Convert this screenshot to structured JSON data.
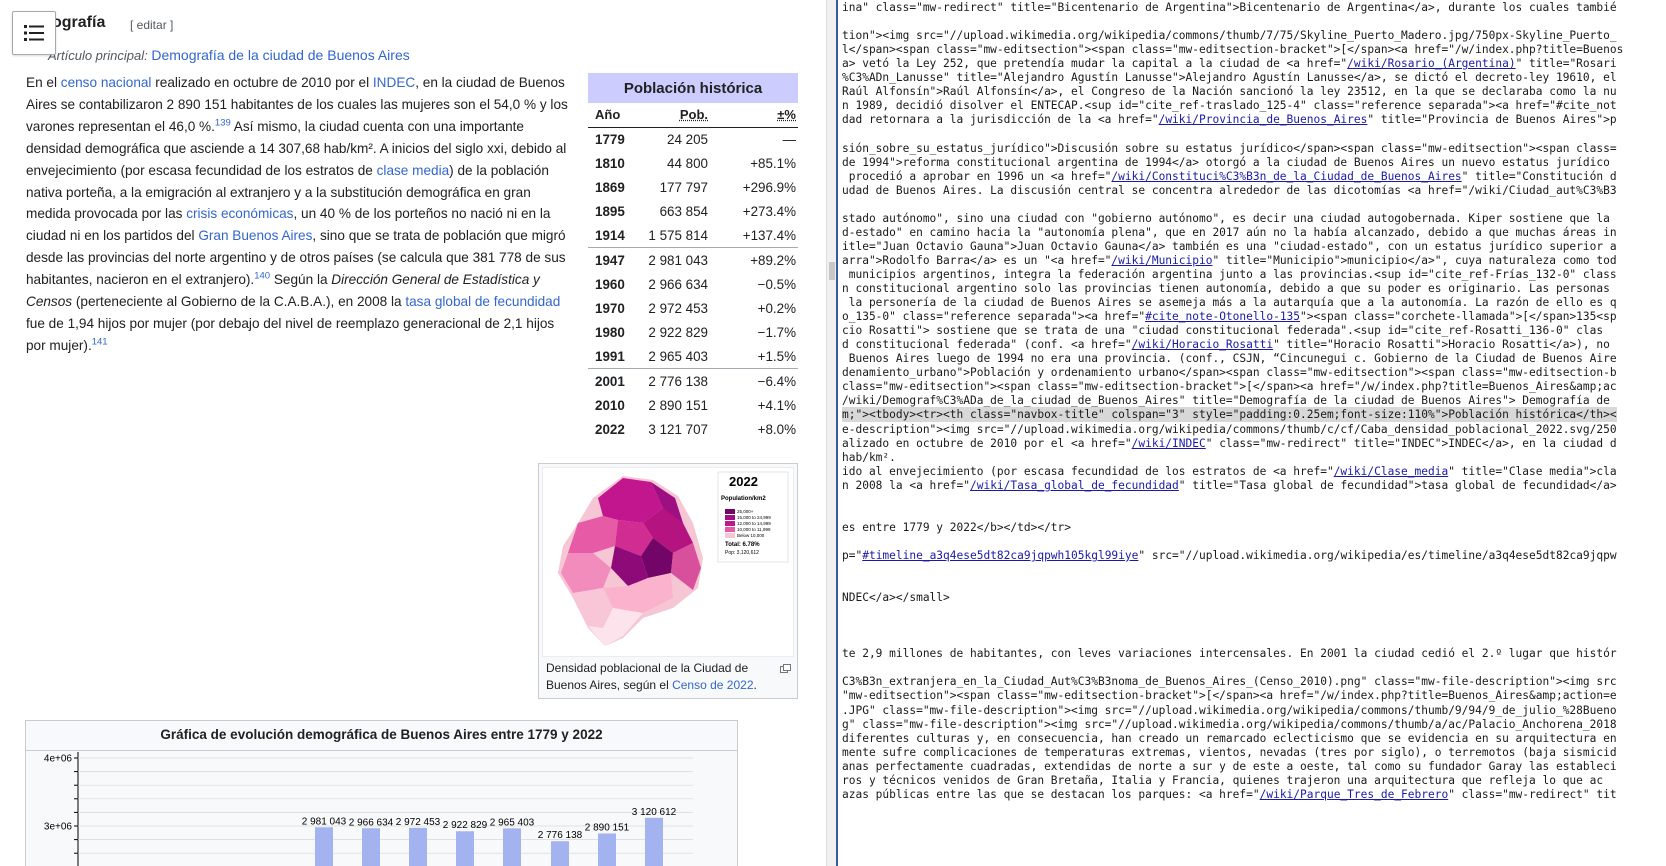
{
  "article": {
    "heading": "ografía",
    "edit_link": "[ editar ]",
    "main_article_label": "Artículo principal:",
    "main_article_link": "Demografía de la ciudad de Buenos Aires",
    "paragraph_html": "En el <a>censo nacional</a> realizado en octubre de 2010 por el <a>INDEC</a>, en la ciudad de Buenos Aires se contabilizaron 2 890 151 habitantes de los cuales las mujeres son el 54,0 % y los varones representan el 46,0 %.<sup>139</sup> Así mismo, la ciudad cuenta con una importante densidad demográfica que asciende a 14 307,68 hab/km². A inicios del siglo xxi, debido al envejecimiento (por escasa fecundidad de los estratos de <a>clase media</a>) de la población nativa porteña, a la emigración al extranjero y a la substitución demográfica en gran medida provocada por las <a>crisis económicas</a>, un 40 % de los porteños no nació ni en la ciudad ni en los partidos del <a>Gran Buenos Aires</a>, sino que se trata de población que migró desde las provincias del norte argentino y de otros países (se calcula que 381 778 de sus habitantes, nacieron en el extranjero).<sup>140</sup> Según la <i>Dirección General de Estadística y Censos</i> (perteneciente al Gobierno de la C.A.B.A.), en 2008 la <a>tasa global de fecundidad</a> fue de 1,94 hijos por mujer (por debajo del nivel de reemplazo generacional de 2,1 hijos por mujer).<sup>141</sup>"
  },
  "population_table": {
    "title": "Población histórica",
    "headers": [
      "Año",
      "Pob.",
      "±%"
    ],
    "rows": [
      [
        "1779",
        "24 205",
        "—"
      ],
      [
        "1810",
        "44 800",
        "+85.1%"
      ],
      [
        "1869",
        "177 797",
        "+296.9%"
      ],
      [
        "1895",
        "663 854",
        "+273.4%"
      ],
      [
        "1914",
        "1 575 814",
        "+137.4%"
      ],
      [
        "1947",
        "2 981 043",
        "+89.2%"
      ],
      [
        "1960",
        "2 966 634",
        "−0.5%"
      ],
      [
        "1970",
        "2 972 453",
        "+0.2%"
      ],
      [
        "1980",
        "2 922 829",
        "−1.7%"
      ],
      [
        "1991",
        "2 965 403",
        "+1.5%"
      ],
      [
        "2001",
        "2 776 138",
        "−6.4%"
      ],
      [
        "2010",
        "2 890 151",
        "+4.1%"
      ],
      [
        "2022",
        "3 121 707",
        "+8.0%"
      ]
    ]
  },
  "map_figure": {
    "year": "2022",
    "legend_title": "Population/km2",
    "legend_items": [
      "25,000+",
      "15,000 to 24,999",
      "12,000 to 14,999",
      "10,000 to 11,999",
      "Below 10,000"
    ],
    "total_text": "Total: 6.78%",
    "pop_text": "Pop: 3,120,612",
    "caption_pre": "Densidad poblacional de la Ciudad de Buenos Aires, según el ",
    "caption_link": "Censo de 2022",
    "caption_post": "."
  },
  "chart_box": {
    "title": "Gráfica de evolución demográfica de Buenos Aires entre 1779 y 2022"
  },
  "chart_data": {
    "type": "bar",
    "title": "Gráfica de evolución demográfica de Buenos Aires entre 1779 y 2022",
    "y_ticks": [
      "4e+06",
      "3e+06"
    ],
    "bar_labels": [
      "2 981 043",
      "2 966 634",
      "2 972 453",
      "2 922 829",
      "2 965 403",
      "2 776 138",
      "2 890 151",
      "3 120 612"
    ],
    "values": [
      2981043,
      2966634,
      2972453,
      2922829,
      2965403,
      2776138,
      2890151,
      3120612
    ],
    "ylim": [
      0,
      4000000
    ]
  },
  "source_lines": [
    "ina\" class=\"mw-redirect\" title=\"Bicentenario de Argentina\">Bicentenario de Argentina</a>, durante los cuales tambié",
    "",
    "tion\"><img src=\"//upload.wikimedia.org/wikipedia/commons/thumb/7/75/Skyline_Puerto_Madero.jpg/750px-Skyline_Puerto_",
    "l</span><span class=\"mw-editsection\"><span class=\"mw-editsection-bracket\">[</span><a href=\"/w/index.php?title=Buenos",
    "a> vetó la Ley 252, que pretendía mudar la capital a la ciudad de <a href=\"/wiki/Rosario_(Argentina)\" title=\"Rosari",
    "%C3%ADn_Lanusse\" title=\"Alejandro Agustín Lanusse\">Alejandro Agustín Lanusse</a>, se dictó el decreto-ley 19610, el",
    "Raúl Alfonsín\">Raúl Alfonsín</a>, el Congreso de la Nación sancionó la ley 23512, en la que se declaraba como la nu",
    "n 1989, decidió disolver el ENTECAP.<sup id=\"cite_ref-traslado_125-4\" class=\"reference separada\"><a href=\"#cite_not",
    "dad retornara a la jurisdicción de la <a href=\"/wiki/Provincia_de_Buenos_Aires\" title=\"Provincia de Buenos Aires\">p",
    "",
    "sión_sobre_su_estatus_jurídico\">Discusión sobre su estatus jurídico</span><span class=\"mw-editsection\"><span class=",
    "de 1994\">reforma constitucional argentina de 1994</a> otorgó a la ciudad de Buenos Aires un nuevo estatus jurídico",
    " procedió a aprobar en 1996 un <a href=\"/wiki/Constituci%C3%B3n_de_la_Ciudad_de_Buenos_Aires\" title=\"Constitución d",
    "udad de Buenos Aires. La discusión central se concentra alrededor de las dicotomías <a href=\"/wiki/Ciudad_aut%C3%B3",
    "",
    "stado autónomo\", sino una ciudad con \"gobierno autónomo\", es decir una ciudad autogobernada. Kiper sostiene que la",
    "d-estado\" en camino hacia la \"autonomía plena\", que en 2017 aún no la había alcanzado, debido a que muchas áreas in",
    "itle=\"Juan Octavio Gauna\">Juan Octavio Gauna</a> también es una \"ciudad-estado\", con un estatus jurídico superior a",
    "arra\">Rodolfo Barra</a> es un \"<a href=\"/wiki/Municipio\" title=\"Municipio\">municipio</a>\", cuya naturaleza como tod",
    " municipios argentinos, integra la federación argentina junto a las provincias.<sup id=\"cite_ref-Frías_132-0\" class",
    "n constitucional argentino solo las provincias tienen autonomía, debido a que su poder es originario. Las personas",
    " la personería de la ciudad de Buenos Aires se asemeja más a la autarquía que a la autonomía. La razón de ello es q",
    "o_135-0\" class=\"reference separada\"><a href=\"#cite_note-Otonello-135\"><span class=\"corchete-llamada\">[</span>135<sp",
    "cio Rosatti\"> sostiene que se trata de una \"ciudad constitucional federada\".<sup id=\"cite_ref-Rosatti_136-0\" clas",
    "d constitucional federada\" (conf. <a href=\"/wiki/Horacio_Rosatti\" title=\"Horacio Rosatti\">Horacio Rosatti</a>), no",
    " Buenos Aires luego de 1994 no era una provincia. (conf., CSJN, “Cincunegui c. Gobierno de la Ciudad de Buenos Aire",
    "denamiento_urbano\">Población y ordenamiento urbano</span><span class=\"mw-editsection\"><span class=\"mw-editsection-b",
    "class=\"mw-editsection\"><span class=\"mw-editsection-bracket\">[</span><a href=\"/w/index.php?title=Buenos_Aires&amp;ac",
    "/wiki/Demograf%C3%ADa_de_la_ciudad_de_Buenos_Aires\" title=\"Demografía de la ciudad de Buenos Aires\"> Demografía de",
    "m;\"><tbody><tr><th class=\"navbox-title\" colspan=\"3\" style=\"padding:0.25em;font-size:110%\">Población histórica</th><",
    "e-description\"><img src=\"//upload.wikimedia.org/wikipedia/commons/thumb/c/cf/Caba_densidad_poblacional_2022.svg/250",
    "alizado en octubre de 2010 por el <a href=\"/wiki/INDEC\" class=\"mw-redirect\" title=\"INDEC\">INDEC</a>, en la ciudad d",
    "hab/km².",
    "ido al envejecimiento (por escasa fecundidad de los estratos de <a href=\"/wiki/Clase_media\" title=\"Clase media\">cla",
    "n 2008 la <a href=\"/wiki/Tasa_global_de_fecundidad\" title=\"Tasa global de fecundidad\">tasa global de fecundidad</a>",
    "",
    "",
    "es entre 1779 y 2022</b></td></tr>",
    "",
    "p=\"#timeline_a3q4ese5dt82ca9jqpwh105kgl99iye\" src=\"//upload.wikimedia.org/wikipedia/es/timeline/a3q4ese5dt82ca9jqpw",
    "",
    "",
    "NDEC</a></small>",
    "",
    "",
    "",
    "te 2,9 millones de habitantes, con leves variaciones intercensales. En 2001 la ciudad cedió el 2.º lugar que histór",
    "",
    "C3%B3n_extranjera_en_la_Ciudad_Aut%C3%B3noma_de_Buenos_Aires_(Censo_2010).png\" class=\"mw-file-description\"><img src",
    "\"mw-editsection\"><span class=\"mw-editsection-bracket\">[</span><a href=\"/w/index.php?title=Buenos_Aires&amp;action=e",
    ".JPG\" class=\"mw-file-description\"><img src=\"//upload.wikimedia.org/wikipedia/commons/thumb/9/94/9_de_julio_%28Bueno",
    "g\" class=\"mw-file-description\"><img src=\"//upload.wikimedia.org/wikipedia/commons/thumb/a/ac/Palacio_Anchorena_2018",
    "diferentes culturas y, en consecuencia, han creado un remarcado eclecticismo que se evidencia en su arquitectura en",
    "mente sufre complicaciones de temperaturas extremas, vientos, nevadas (tres por siglo), o terremotos (baja sismicid",
    "anas perfectamente cuadradas, extendidas de norte a sur y de este a oeste, tal como su fundador Garay las estableci",
    "ros y técnicos venidos de Gran Bretaña, Italia y Francia, quienes trajeron una arquitectura que refleja lo que ac",
    "azas públicas entre las que se destacan los parques: <a href=\"/wiki/Parque_Tres_de_Febrero\" class=\"mw-redirect\" tit"
  ]
}
